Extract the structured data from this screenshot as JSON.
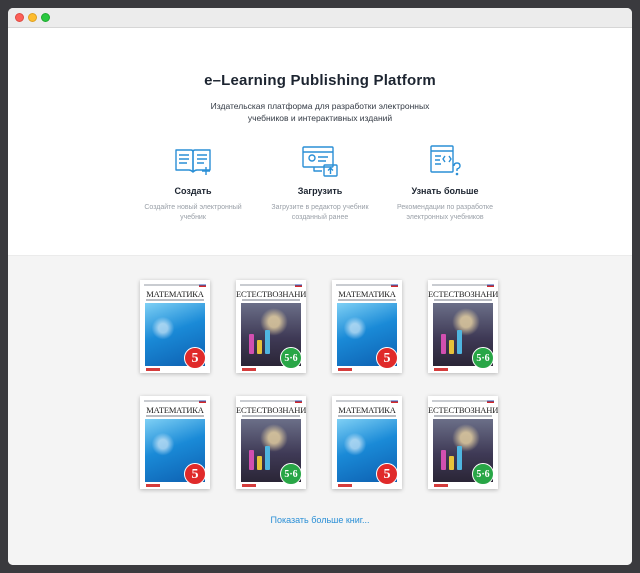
{
  "hero": {
    "title": "e–Learning Publishing Platform",
    "subtitle_line1": "Издательская платформа для разработки электронных",
    "subtitle_line2": "учебников и интерактивных изданий"
  },
  "features": [
    {
      "icon": "open-book-icon",
      "title": "Создать",
      "desc_line1": "Создайте новый электронный",
      "desc_line2": "учебник"
    },
    {
      "icon": "upload-monitor-icon",
      "title": "Загрузить",
      "desc_line1": "Загрузите в редактор учебник",
      "desc_line2": "созданный ранее"
    },
    {
      "icon": "code-help-icon",
      "title": "Узнать больше",
      "desc_line1": "Рекомендации по разработке",
      "desc_line2": "электронных учебников"
    }
  ],
  "books": [
    {
      "kind": "math",
      "title": "МАТЕМАТИКА",
      "grade": "5"
    },
    {
      "kind": "nature",
      "title": "ЕСТЕСТВОЗНАНИЕ",
      "grade": "5·6"
    },
    {
      "kind": "math",
      "title": "МАТЕМАТИКА",
      "grade": "5"
    },
    {
      "kind": "nature",
      "title": "ЕСТЕСТВОЗНАНИЕ",
      "grade": "5·6"
    },
    {
      "kind": "math",
      "title": "МАТЕМАТИКА",
      "grade": "5"
    },
    {
      "kind": "nature",
      "title": "ЕСТЕСТВОЗНАНИЕ",
      "grade": "5·6"
    },
    {
      "kind": "math",
      "title": "МАТЕМАТИКА",
      "grade": "5"
    },
    {
      "kind": "nature",
      "title": "ЕСТЕСТВОЗНАНИЕ",
      "grade": "5·6"
    }
  ],
  "more_link": "Показать больше книг...",
  "colors": {
    "accent": "#2a8fd6",
    "math_badge": "#e02a2a",
    "nature_badge": "#28a646"
  }
}
